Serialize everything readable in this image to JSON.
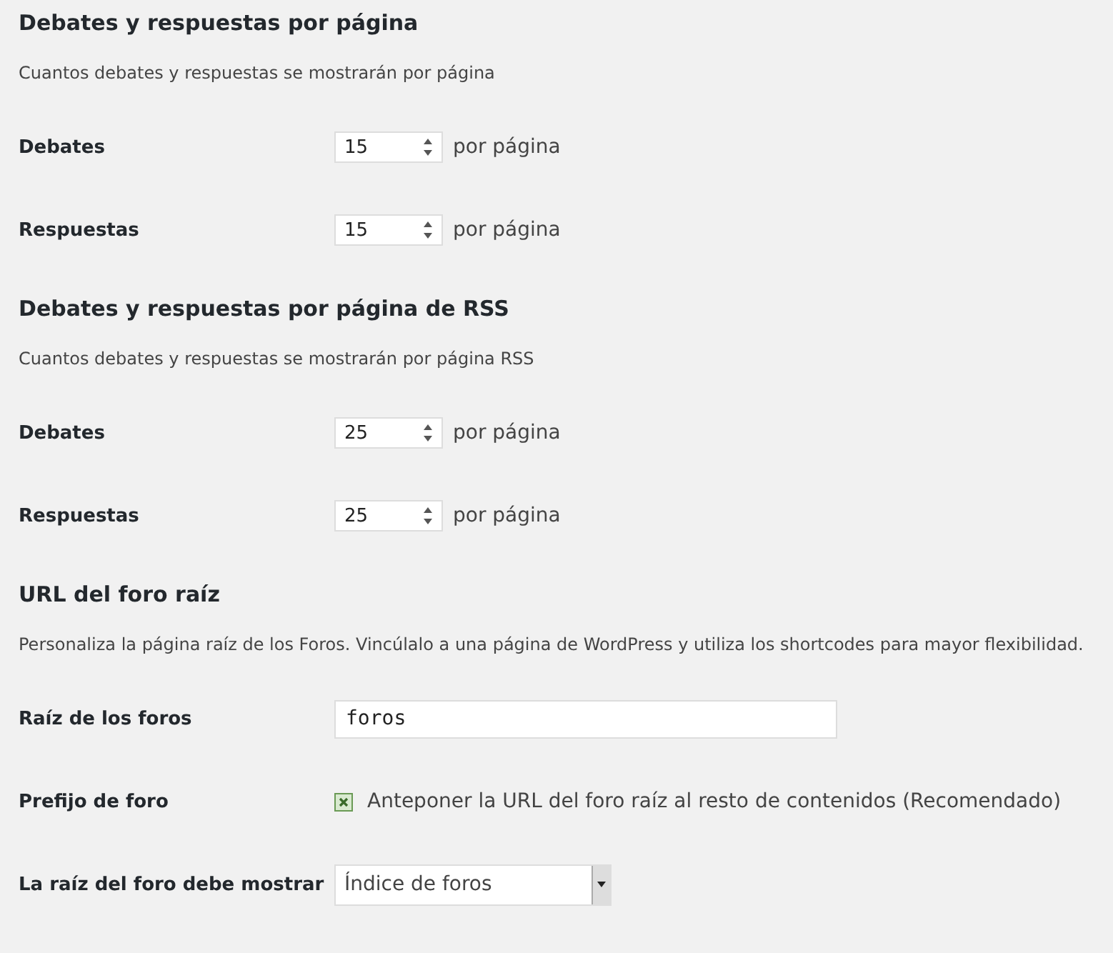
{
  "sections": [
    {
      "title": "Debates y respuestas por página",
      "description": "Cuantos debates y respuestas se mostrarán por página",
      "fields": [
        {
          "kind": "number",
          "label": "Debates",
          "value": "15",
          "suffix": "por página"
        },
        {
          "kind": "number",
          "label": "Respuestas",
          "value": "15",
          "suffix": "por página"
        }
      ]
    },
    {
      "title": "Debates y respuestas por página de RSS",
      "description": "Cuantos debates y respuestas se mostrarán por página RSS",
      "fields": [
        {
          "kind": "number",
          "label": "Debates",
          "value": "25",
          "suffix": "por página"
        },
        {
          "kind": "number",
          "label": "Respuestas",
          "value": "25",
          "suffix": "por página"
        }
      ]
    },
    {
      "title": "URL del foro raíz",
      "description": "Personaliza la página raíz de los Foros. Vincúlalo a una página de WordPress y utiliza los shortcodes para mayor flexibilidad.",
      "fields": [
        {
          "kind": "text",
          "label": "Raíz de los foros",
          "value": "foros"
        },
        {
          "kind": "checkbox",
          "label": "Prefijo de foro",
          "text": "Anteponer la URL del foro raíz al resto de contenidos (Recomendado)",
          "checked": true
        },
        {
          "kind": "select",
          "label": "La raíz del foro debe mostrar",
          "value": "Índice de foros"
        }
      ]
    }
  ]
}
